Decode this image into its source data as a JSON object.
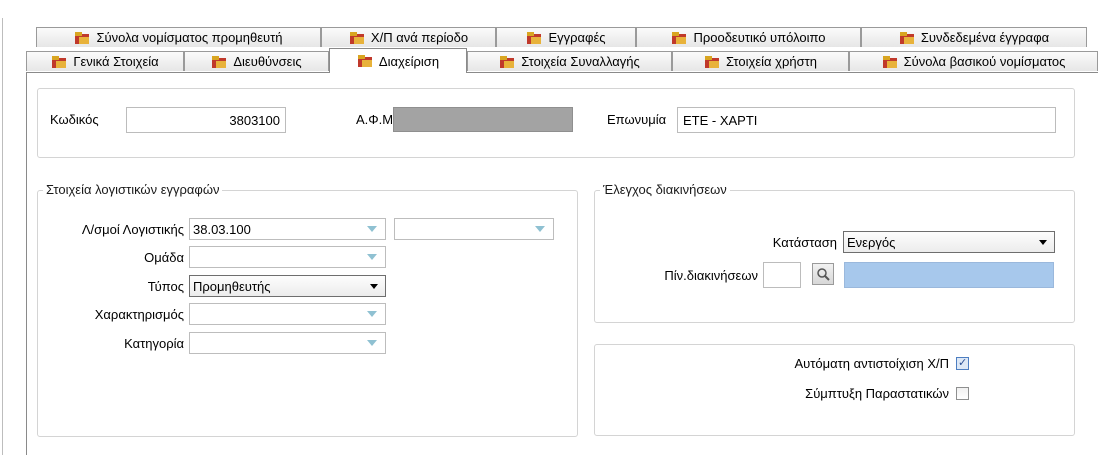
{
  "tabs_back": [
    {
      "label": "Σύνολα νομίσματος προμηθευτή",
      "name": "tab-supplier-currency-totals"
    },
    {
      "label": "Χ/Π ανά περίοδο",
      "name": "tab-debit-credit-per-period"
    },
    {
      "label": "Εγγραφές",
      "name": "tab-entries"
    },
    {
      "label": "Προοδευτικό υπόλοιπο",
      "name": "tab-progressive-balance"
    },
    {
      "label": "Συνδεδεμένα έγγραφα",
      "name": "tab-linked-documents"
    }
  ],
  "tabs_front": [
    {
      "label": "Γενικά Στοιχεία",
      "name": "tab-general"
    },
    {
      "label": "Διευθύνσεις",
      "name": "tab-addresses"
    },
    {
      "label": "Διαχείριση",
      "name": "tab-management"
    },
    {
      "label": "Στοιχεία Συναλλαγής",
      "name": "tab-transaction-details"
    },
    {
      "label": "Στοιχεία χρήστη",
      "name": "tab-user-details"
    },
    {
      "label": "Σύνολα βασικού νομίσματος",
      "name": "tab-base-currency-totals"
    }
  ],
  "header": {
    "code_label": "Κωδικός",
    "code_value": "3803100",
    "vat_label": "Α.Φ.Μ",
    "name_label": "Επωνυμία",
    "name_value": "ΕΤΕ - ΧΑΡΤΙ"
  },
  "accounting": {
    "legend": "Στοιχεία λογιστικών εγγραφών",
    "accounts_label": "Λ/σμοί Λογιστικής",
    "accounts_value": "38.03.100",
    "accounts_value2": "",
    "group_label": "Ομάδα",
    "group_value": "",
    "type_label": "Τύπος",
    "type_value": "Προμηθευτής",
    "characterization_label": "Χαρακτηρισμός",
    "characterization_value": "",
    "category_label": "Κατηγορία",
    "category_value": ""
  },
  "clearing": {
    "legend": "Έλεγχος διακινήσεων",
    "status_label": "Κατάσταση",
    "status_value": "Ενεργός",
    "table_label": "Πίν.διακινήσεων",
    "table_value": ""
  },
  "options": {
    "auto_match_label": "Αυτόματη αντιστοίχιση Χ/Π",
    "auto_match_checked": true,
    "compress_label": "Σύμπτυξη Παραστατικών",
    "compress_checked": false
  },
  "colors": {
    "tab_icon_red": "#c0392b",
    "tab_icon_gold": "#d9a521",
    "lookup_blue": "#a7c8ec"
  }
}
